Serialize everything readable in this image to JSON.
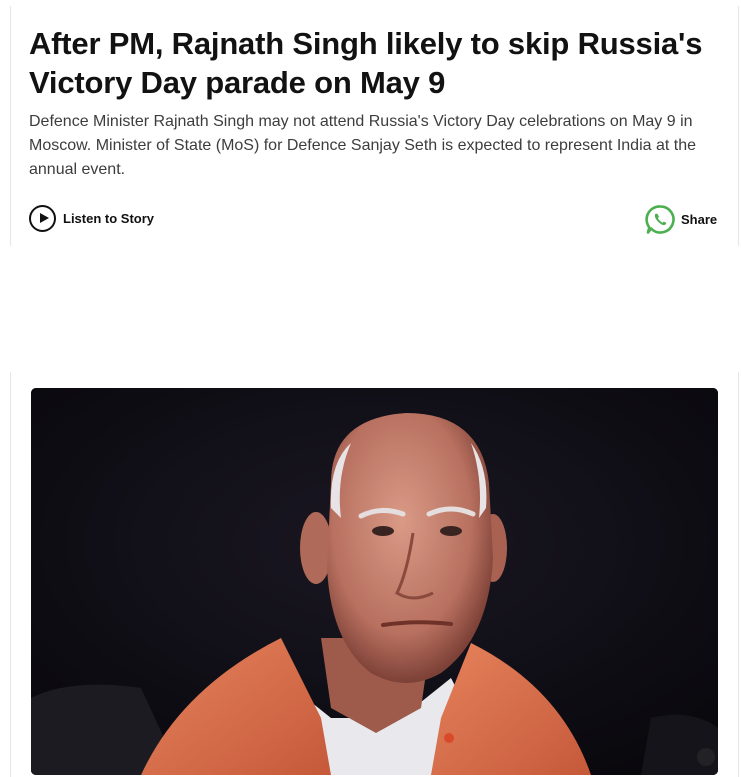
{
  "article": {
    "headline": "After PM, Rajnath Singh likely to skip Russia's Victory Day parade on May 9",
    "summary": "Defence Minister Rajnath Singh may not attend Russia's Victory Day celebrations on May 9 in Moscow. Minister of State (MoS) for Defence Sanjay Seth is expected to represent India at the annual event."
  },
  "actions": {
    "listen_label": "Listen to Story",
    "listen_icon": "play-circle-icon",
    "share_label": "Share",
    "share_icon": "whatsapp-icon"
  },
  "colors": {
    "text": "#121212",
    "summary_text": "#3d3d3d",
    "whatsapp": "#4caf50"
  }
}
